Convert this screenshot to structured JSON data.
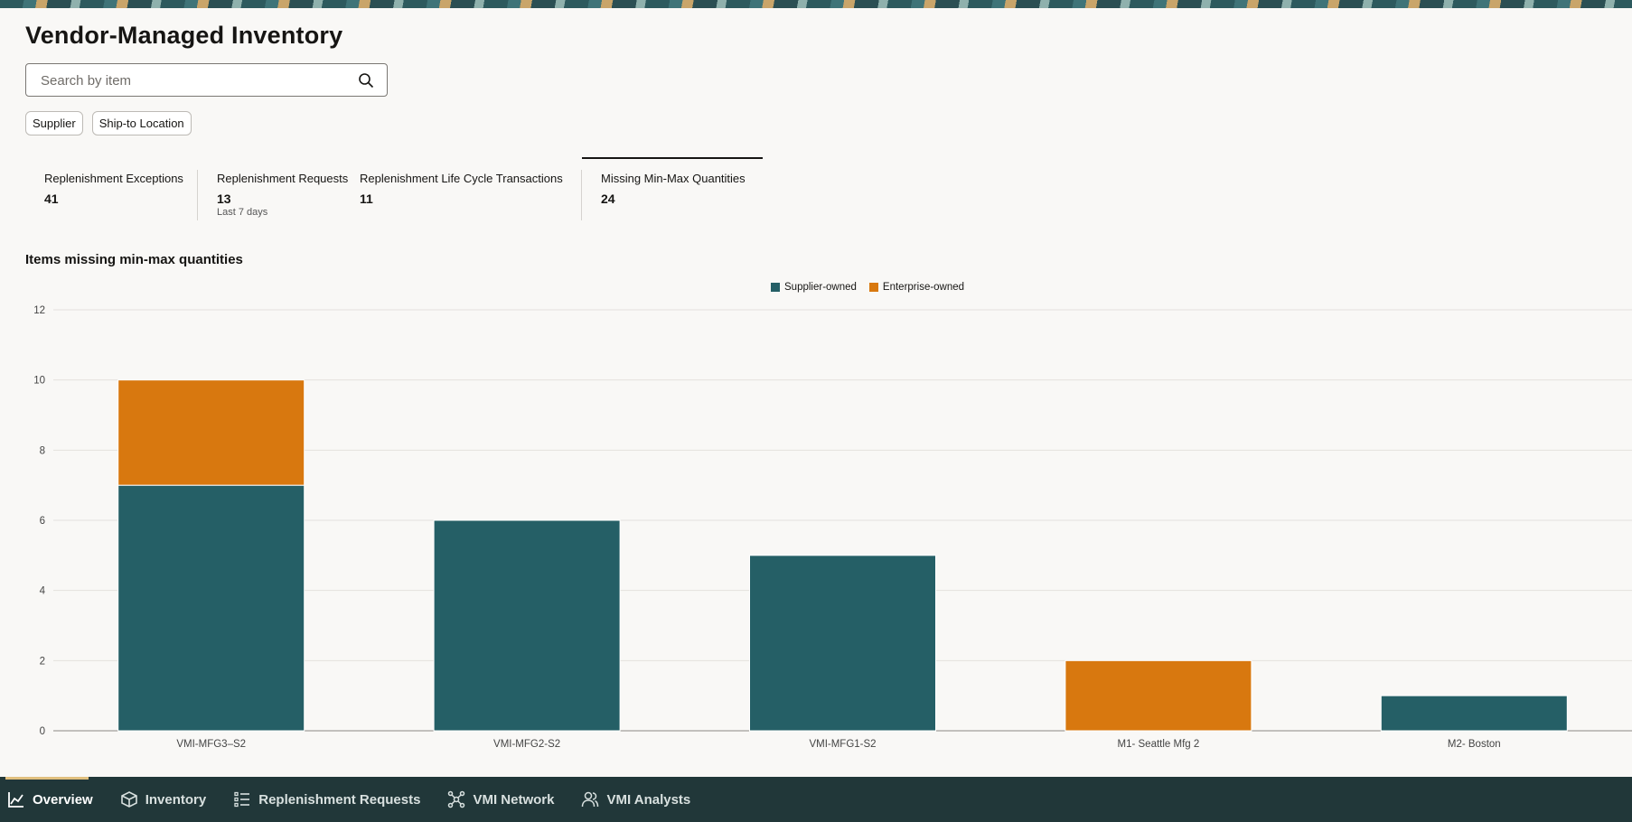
{
  "page": {
    "title": "Vendor-Managed Inventory"
  },
  "search": {
    "placeholder": "Search by item"
  },
  "filters": [
    {
      "label": "Supplier"
    },
    {
      "label": "Ship-to Location"
    }
  ],
  "metrics": [
    {
      "label": "Replenishment Exceptions",
      "value": "41",
      "sub": ""
    },
    {
      "label": "Replenishment Requests",
      "value": "13",
      "sub": "Last 7 days"
    },
    {
      "label": "Replenishment Life Cycle Transactions",
      "value": "11",
      "sub": ""
    },
    {
      "label": "Missing Min-Max Quantities",
      "value": "24",
      "sub": "",
      "active": true
    }
  ],
  "section": {
    "title": "Items missing min-max quantities"
  },
  "colors": {
    "supplier": "#255f66",
    "enterprise": "#d8780f",
    "nav_bg": "#213739",
    "nav_indicator": "#e0bf7e"
  },
  "chart_data": {
    "type": "bar",
    "stacked": true,
    "title": "",
    "xlabel": "",
    "ylabel": "",
    "categories": [
      "VMI-MFG3–S2",
      "VMI-MFG2-S2",
      "VMI-MFG1-S2",
      "M1- Seattle Mfg 2",
      "M2- Boston"
    ],
    "series": [
      {
        "name": "Supplier-owned",
        "color": "#255f66",
        "values": [
          7,
          6,
          5,
          0,
          1
        ]
      },
      {
        "name": "Enterprise-owned",
        "color": "#d8780f",
        "values": [
          3,
          0,
          0,
          2,
          0
        ]
      }
    ],
    "ylim": [
      0,
      12
    ],
    "yticks": [
      0,
      2,
      4,
      6,
      8,
      10,
      12
    ],
    "grid": true,
    "legend": "top-center"
  },
  "nav": [
    {
      "label": "Overview",
      "icon": "line-chart-icon",
      "active": true
    },
    {
      "label": "Inventory",
      "icon": "cube-icon"
    },
    {
      "label": "Replenishment Requests",
      "icon": "list-icon"
    },
    {
      "label": "VMI Network",
      "icon": "network-icon"
    },
    {
      "label": "VMI Analysts",
      "icon": "users-icon"
    }
  ]
}
